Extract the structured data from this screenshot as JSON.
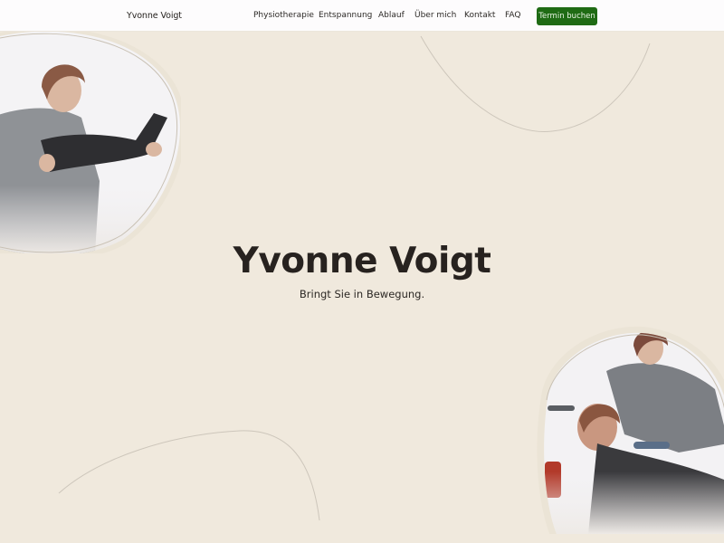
{
  "header": {
    "logo": "Yvonne Voigt",
    "nav": [
      "Physiotherapie",
      "Entspannung",
      "Ablauf",
      "Über mich",
      "Kontakt",
      "FAQ"
    ],
    "cta_label": "Termin buchen"
  },
  "hero": {
    "title": "Yvonne Voigt",
    "subtitle": "Bringt Sie in Bewegung."
  },
  "colors": {
    "background": "#f0e9dd",
    "header_bg": "#fdfcfd",
    "cta_bg": "#1f6b14",
    "text": "#27221f"
  }
}
